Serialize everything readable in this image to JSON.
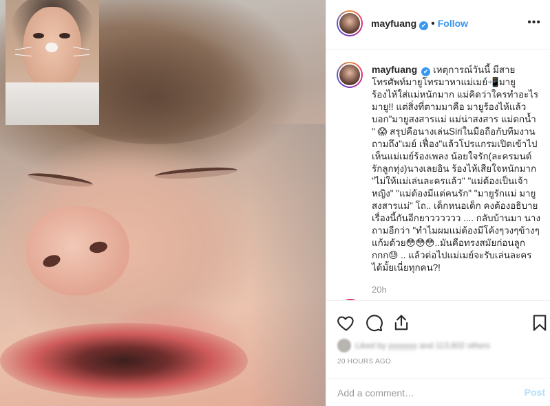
{
  "post": {
    "username": "mayfuang",
    "verified_glyph": "✔",
    "follow_label": "Follow",
    "separator": "•",
    "more_glyph": "•••"
  },
  "caption": {
    "username": "mayfuang",
    "verified_glyph": "✔",
    "text": "เหตุการณ์วันนี้ มีสายโทรศัพท์มายูโทรมาหาแม่เมย์📲มายูร้องไห้ใส่แม่หนักมาก แม่คิดว่าใครทำอะไรมายู!! แต่สิ่งที่ตามมาคือ มายูร้องไห้แล้วบอก\"มายูสงสารแม่ แม่น่าสงสาร แม่ตกน้ำ \" 😱 สรุปคือนางเล่นSiriในมือถือกับทีมงาน ถามถึง\"เมย์ เฟื่อง\"แล้วโปรแกรมเปิดเข้าไปเห็นแม่เมย์ร้องเพลง น้อยใจรัก(ละครมนต์รักลูกทุ่ง)นางเลยอิน ร้องไห้เสียใจหนักมาก \"ไม่ให้แม่เล่นละครแล้ว\" \"แม่ต้องเป็นเจ้าหญิง\" \"แม่ต้องมีแต่คนรัก\" \"มายูรักแม่ มายูสงสารแม่\" โถ.. เด็กหนอเด็ก คงต้องอธิบายเรื่องนี้กันอีกยาวววววว .... กลับบ้านมา นางถามอีกว่า \"ทำไมผมแม่ต้องมีโค้งๆวงๆข้างๆแก้มด้วย😳😳😳..มันคือทรงสมัยก่อนลูกกกก😓 .. แล้วต่อไปแม่เมย์จะรับเล่นละครได้มั้ยเนี่ยทุกคน?!",
    "time": "20h"
  },
  "actions": {
    "like_icon": "heart-icon",
    "comment_icon": "comment-icon",
    "share_icon": "share-icon",
    "save_icon": "bookmark-icon"
  },
  "likes": {
    "text": "Liked by yyyyyyy and 113,602 others"
  },
  "timestamp": "20 HOURS AGO",
  "comment_box": {
    "placeholder": "Add a comment…",
    "post_label": "Post"
  },
  "colors": {
    "accent": "#3897f0",
    "post_disabled": "#b2dffc",
    "muted": "#999999"
  }
}
